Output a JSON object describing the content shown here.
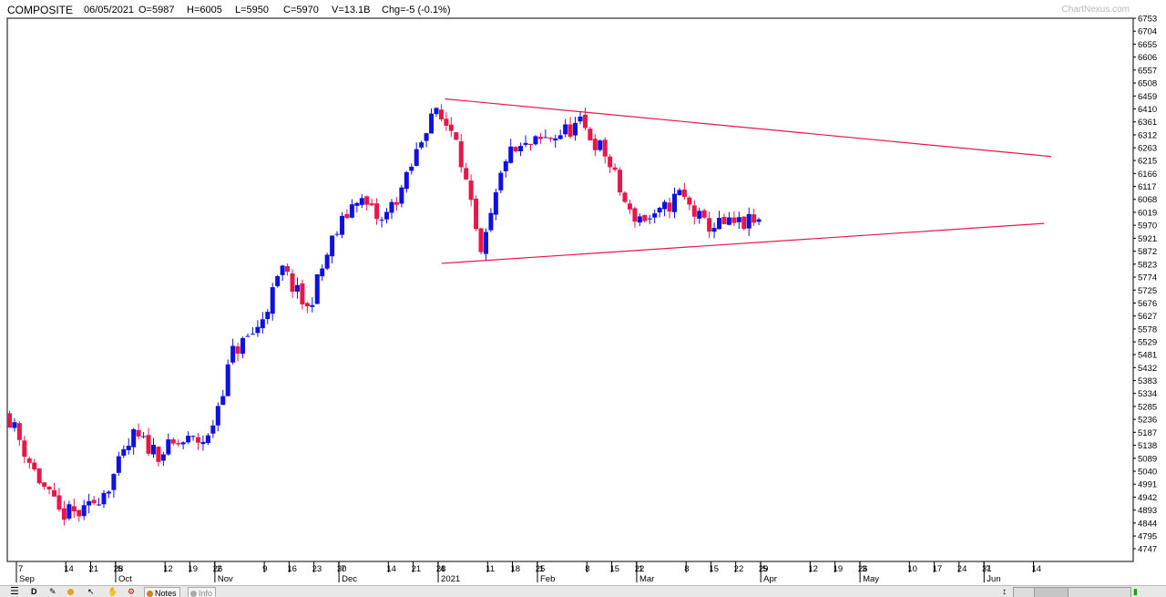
{
  "header": {
    "symbol": "COMPOSITE",
    "date": "06/05/2021",
    "open": "O=5987",
    "high": "H=6005",
    "low": "L=5950",
    "close": "C=5970",
    "volume": "V=13.1B",
    "change": "Chg=-5 (-0.1%)",
    "watermark": "ChartNexus.com"
  },
  "toolbar": {
    "menu_icon": "hamburger-icon",
    "period_label": "D",
    "notes_label": "Notes",
    "info_label": "Info"
  },
  "colors": {
    "up": "#1010e0",
    "down": "#e8174a",
    "trendline": "#e8174a"
  },
  "chart_data": {
    "type": "candlestick",
    "title": "",
    "xlabel": "",
    "ylabel": "",
    "ylim": [
      4747,
      6753
    ],
    "y_ticks": [
      4747,
      4795,
      4844,
      4893,
      4942,
      4991,
      5040,
      5089,
      5138,
      5187,
      5236,
      5285,
      5334,
      5383,
      5432,
      5481,
      5529,
      5578,
      5627,
      5676,
      5725,
      5774,
      5823,
      5872,
      5921,
      5970,
      6019,
      6068,
      6117,
      6166,
      6215,
      6263,
      6312,
      6361,
      6410,
      6459,
      6508,
      6557,
      6606,
      6655,
      6704,
      6753
    ],
    "x_ticks": [
      {
        "label": "7",
        "month": "Sep"
      },
      {
        "label": "14",
        "month": ""
      },
      {
        "label": "21",
        "month": ""
      },
      {
        "label": "28",
        "month": ""
      },
      {
        "label": "5",
        "month": "Oct"
      },
      {
        "label": "12",
        "month": ""
      },
      {
        "label": "19",
        "month": ""
      },
      {
        "label": "26",
        "month": ""
      },
      {
        "label": "2",
        "month": "Nov"
      },
      {
        "label": "9",
        "month": ""
      },
      {
        "label": "16",
        "month": ""
      },
      {
        "label": "23",
        "month": ""
      },
      {
        "label": "30",
        "month": ""
      },
      {
        "label": "7",
        "month": "Dec"
      },
      {
        "label": "14",
        "month": ""
      },
      {
        "label": "21",
        "month": ""
      },
      {
        "label": "28",
        "month": ""
      },
      {
        "label": "4",
        "month": "2021"
      },
      {
        "label": "11",
        "month": ""
      },
      {
        "label": "18",
        "month": ""
      },
      {
        "label": "25",
        "month": ""
      },
      {
        "label": "1",
        "month": "Feb"
      },
      {
        "label": "8",
        "month": ""
      },
      {
        "label": "15",
        "month": ""
      },
      {
        "label": "22",
        "month": ""
      },
      {
        "label": "1",
        "month": "Mar"
      },
      {
        "label": "8",
        "month": ""
      },
      {
        "label": "15",
        "month": ""
      },
      {
        "label": "22",
        "month": ""
      },
      {
        "label": "29",
        "month": ""
      },
      {
        "label": "5",
        "month": "Apr"
      },
      {
        "label": "12",
        "month": ""
      },
      {
        "label": "19",
        "month": ""
      },
      {
        "label": "26",
        "month": ""
      },
      {
        "label": "3",
        "month": "May"
      },
      {
        "label": "10",
        "month": ""
      },
      {
        "label": "17",
        "month": ""
      },
      {
        "label": "24",
        "month": ""
      },
      {
        "label": "31",
        "month": ""
      },
      {
        "label": "7",
        "month": "Jun"
      },
      {
        "label": "14",
        "month": ""
      }
    ],
    "weekly_closes": [
      5240,
      5040,
      4880,
      4880,
      4990,
      5170,
      5110,
      5150,
      5160,
      5490,
      5580,
      5800,
      5650,
      5910,
      6080,
      5980,
      6140,
      6400,
      6320,
      5840,
      6230,
      6270,
      6310,
      6350,
      6240,
      6010,
      5990,
      6090,
      5970,
      5970,
      5980
    ],
    "trendlines": [
      {
        "name": "resistance",
        "x1": "2020-12-30",
        "y1": 6448,
        "x2": "2021-06-19",
        "y2": 6230
      },
      {
        "name": "support",
        "x1": "2020-12-29",
        "y1": 5826,
        "x2": "2021-06-17",
        "y2": 5977
      }
    ]
  }
}
